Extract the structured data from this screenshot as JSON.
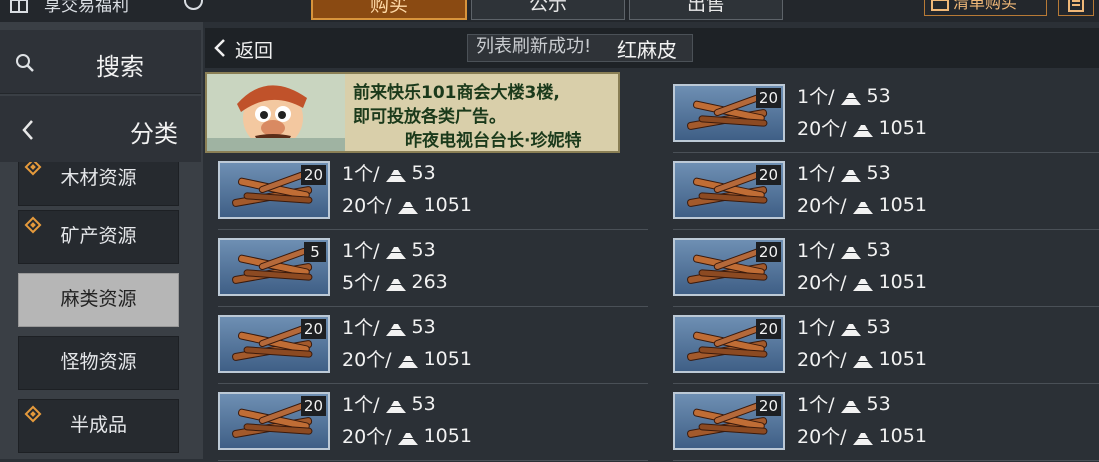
{
  "top": {
    "title": "享交易福利",
    "tabs": [
      "购买",
      "公示",
      "出售"
    ],
    "cart_label": "清单购买"
  },
  "sidebar": {
    "search_label": "搜索",
    "category_label": "分类",
    "categories": [
      {
        "label": "木材资源",
        "marked": true,
        "active": false
      },
      {
        "label": "矿产资源",
        "marked": true,
        "active": false
      },
      {
        "label": "麻类资源",
        "marked": false,
        "active": true
      },
      {
        "label": "怪物资源",
        "marked": false,
        "active": false
      },
      {
        "label": "半成品",
        "marked": true,
        "active": false
      }
    ]
  },
  "header": {
    "back_label": "返回",
    "toast": "列表刷新成功!",
    "item_title": "红麻皮"
  },
  "ad": {
    "line1": "前来快乐101商会大楼3楼,",
    "line2": "即可投放各类广告。",
    "line3": "昨夜电视台台长·珍妮特"
  },
  "listings": [
    {
      "qty": "20",
      "unit_label": "1个/",
      "unit_price": "53",
      "total_label": "20个/",
      "total_price": "1051"
    },
    {
      "qty": "20",
      "unit_label": "1个/",
      "unit_price": "53",
      "total_label": "20个/",
      "total_price": "1051"
    },
    {
      "qty": "20",
      "unit_label": "1个/",
      "unit_price": "53",
      "total_label": "20个/",
      "total_price": "1051"
    },
    {
      "qty": "5",
      "unit_label": "1个/",
      "unit_price": "53",
      "total_label": "5个/",
      "total_price": "263"
    },
    {
      "qty": "20",
      "unit_label": "1个/",
      "unit_price": "53",
      "total_label": "20个/",
      "total_price": "1051"
    },
    {
      "qty": "20",
      "unit_label": "1个/",
      "unit_price": "53",
      "total_label": "20个/",
      "total_price": "1051"
    },
    {
      "qty": "20",
      "unit_label": "1个/",
      "unit_price": "53",
      "total_label": "20个/",
      "total_price": "1051"
    },
    {
      "qty": "20",
      "unit_label": "1个/",
      "unit_price": "53",
      "total_label": "20个/",
      "total_price": "1051"
    },
    {
      "qty": "20",
      "unit_label": "1个/",
      "unit_price": "53",
      "total_label": "20个/",
      "total_price": "1051"
    }
  ],
  "colors": {
    "accent": "#d8943c",
    "active_tab_bg": "#8a4a12",
    "thumb_bg": "#4f6f96"
  },
  "icons": [
    "gift-icon",
    "info-icon",
    "cart-icon",
    "document-icon",
    "search-icon",
    "chevron-left-icon",
    "diamond-marker-icon",
    "wood-bundle-icon",
    "currency-icon"
  ]
}
